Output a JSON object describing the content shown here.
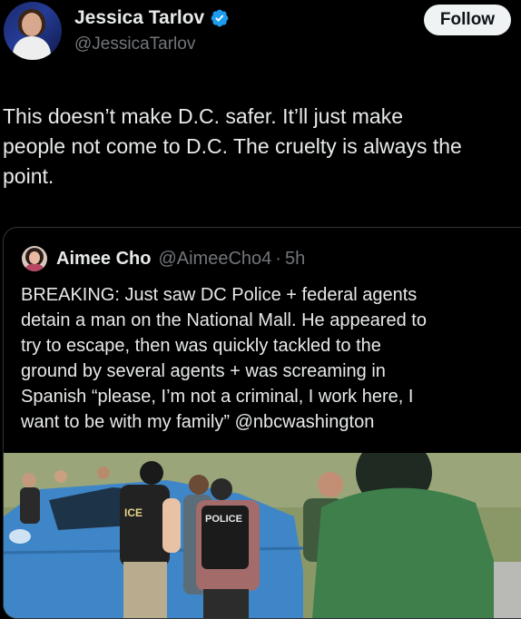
{
  "author": {
    "name": "Jessica Tarlov",
    "handle": "@JessicaTarlov",
    "follow_label": "Follow"
  },
  "tweet": {
    "text": "This doesn’t make D.C. safer. It’ll just make\npeople not come to D.C. The cruelty is always the\npoint."
  },
  "quoted": {
    "name": "Aimee Cho",
    "handle": "@AimeeCho4",
    "separator": "·",
    "age": "5h",
    "text": "BREAKING: Just saw DC Police + federal agents\ndetain a man on the National Mall. He appeared to\ntry to escape, then was quickly tackled to the\nground by several agents + was screaming in\nSpanish “please, I’m not a criminal, I work here, I\nwant to be with my family” @nbcwashington",
    "media": {
      "vest_text_1": "POLICE",
      "vest_text_2": "ICE"
    }
  },
  "colors": {
    "background": "#000000",
    "text": "#e7e9ea",
    "muted": "#71767b",
    "verified": "#1d9bf0",
    "border": "#2f3336"
  },
  "icons": [
    "verified-badge-icon"
  ]
}
